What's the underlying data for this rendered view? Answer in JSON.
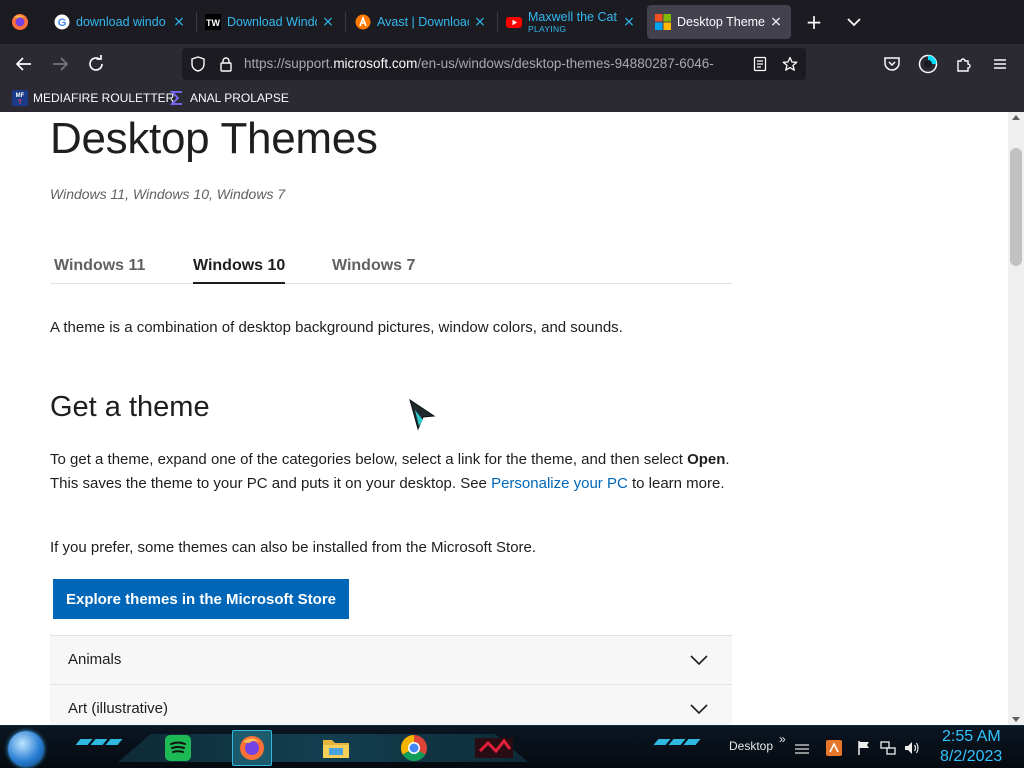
{
  "browser": {
    "tabs": [
      {
        "title": "download windo",
        "favicon": "google-icon",
        "active": false
      },
      {
        "title": "Download Windo",
        "favicon": "tw-icon",
        "active": false
      },
      {
        "title": "Avast | Downloac",
        "favicon": "avast-icon",
        "active": false
      },
      {
        "title": "Maxwell the Cat",
        "subtitle": "PLAYING",
        "favicon": "youtube-icon",
        "active": false
      },
      {
        "title": "Desktop Themes",
        "favicon": "microsoft-icon",
        "active": true
      }
    ],
    "url_prefix": "https://support.",
    "url_host": "microsoft.com",
    "url_suffix": "/en-us/windows/desktop-themes-94880287-6046-",
    "bookmarks": [
      {
        "label": "MEDIAFIRE ROULETTER",
        "icon": "mediafire-icon"
      },
      {
        "label": "ANAL PROLAPSE",
        "icon": "sigma-icon"
      }
    ]
  },
  "page": {
    "title": "Desktop Themes",
    "applies_to": "Windows 11, Windows 10, Windows 7",
    "os_tabs": [
      "Windows 11",
      "Windows 10",
      "Windows 7"
    ],
    "active_os_tab": "Windows 10",
    "intro": "A theme is a combination of desktop background pictures, window colors, and sounds.",
    "section_heading": "Get a theme",
    "instructions_part1": "To get a theme, expand one of the categories below, select a link for the theme, and then select ",
    "instructions_bold": "Open",
    "instructions_part2": ". This saves the theme to your PC and puts it on your desktop. See ",
    "instructions_link": "Personalize your PC",
    "instructions_part3": " to learn more.",
    "store_note": "If you prefer, some themes can also be installed from the Microsoft Store.",
    "store_button": "Explore themes in the Microsoft Store",
    "categories": [
      "Animals",
      "Art (illustrative)"
    ]
  },
  "taskbar": {
    "desktop_label": "Desktop",
    "time": "2:55 AM",
    "date": "8/2/2023",
    "apps": [
      "spotify-icon",
      "firefox-icon",
      "file-explorer-icon",
      "chrome-icon",
      "media-player-icon"
    ]
  },
  "colors": {
    "accent": "#0067b8",
    "tab_text": "#32b9ef",
    "clock": "#33c3ff"
  }
}
